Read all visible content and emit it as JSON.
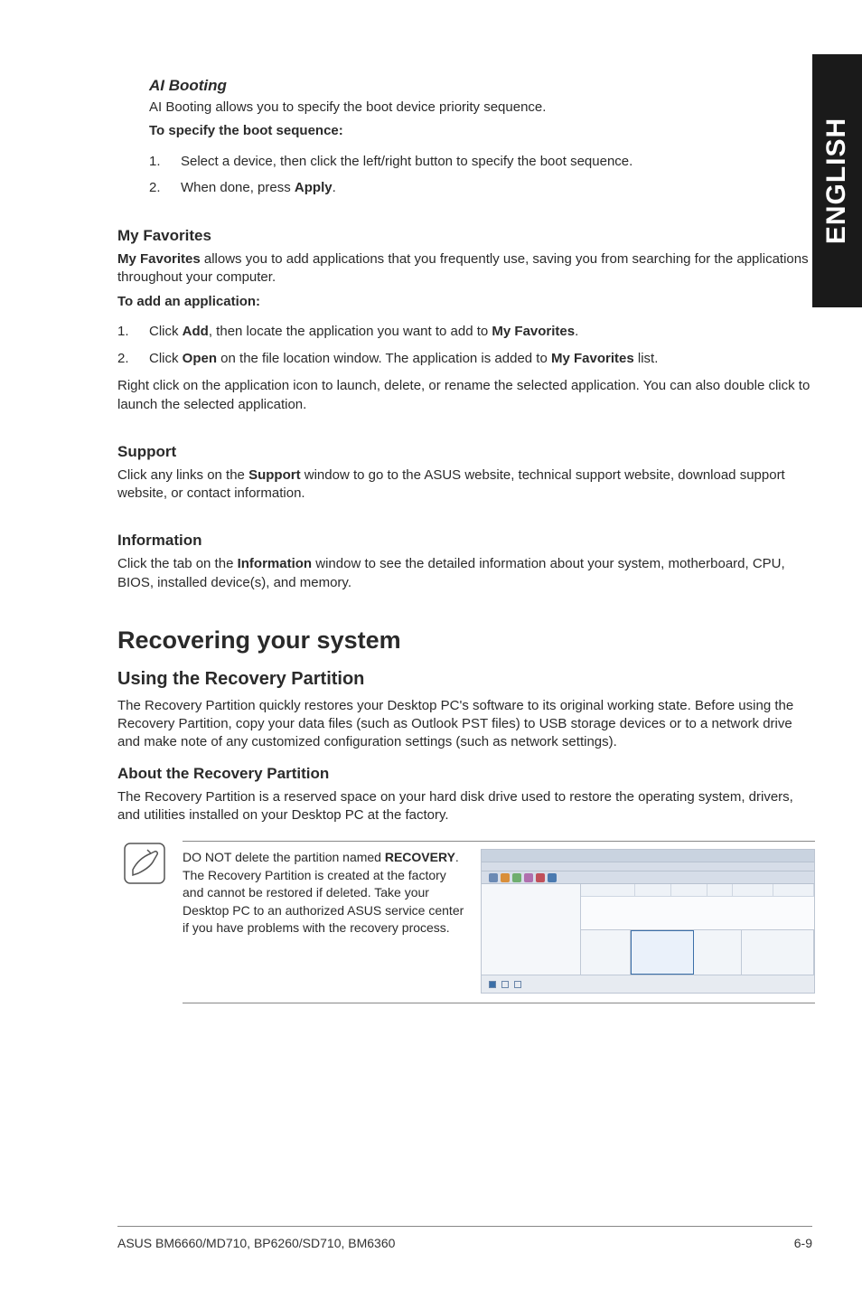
{
  "sideTab": "ENGLISH",
  "aiBooting": {
    "heading": "AI Booting",
    "intro": "AI Booting allows you to specify the boot device priority sequence.",
    "toSpecify": "To specify the boot sequence:",
    "steps": [
      {
        "n": "1.",
        "text_before": "Select a device, then click the left/right button to specify the boot sequence.",
        "bold": "",
        "text_after": ""
      },
      {
        "n": "2.",
        "text_before": "When done, press ",
        "bold": "Apply",
        "text_after": "."
      }
    ]
  },
  "myFav": {
    "heading": "My Favorites",
    "para_b1": "My Favorites",
    "para_t1": " allows you to add applications that you frequently use, saving you from searching for the applications throughout your computer.",
    "toAdd": "To add an application:",
    "steps": [
      {
        "n": "1.",
        "segs": [
          "Click ",
          "Add",
          ", then locate the application you want to add to ",
          "My Favorites",
          "."
        ]
      },
      {
        "n": "2.",
        "segs": [
          "Click ",
          "Open",
          " on the file location window. The application is added to ",
          "My Favorites",
          " list."
        ]
      }
    ],
    "post": "Right click on the application icon to launch, delete, or rename the selected application. You can also double click to launch the selected application."
  },
  "support": {
    "heading": "Support",
    "para_before": "Click any links on the ",
    "para_bold": "Support",
    "para_after": " window to go to the ASUS website, technical support website, download support website, or contact information."
  },
  "info": {
    "heading": "Information",
    "para_before": "Click the tab on the ",
    "para_bold": "Information",
    "para_after": " window to see the detailed information about your system, motherboard, CPU, BIOS, installed device(s), and memory."
  },
  "recovering": {
    "heading": "Recovering your system",
    "sub": "Using the Recovery Partition",
    "para": "The Recovery Partition quickly restores your Desktop PC's software to its original working state. Before using the Recovery Partition, copy your data files (such as Outlook PST files) to USB storage devices or to a network drive and make note of any customized configuration settings (such as network settings).",
    "about": "About the Recovery Partition",
    "aboutPara": "The Recovery Partition is a reserved space on your hard disk drive used to restore the operating system, drivers, and utilities installed on your Desktop PC at the factory."
  },
  "note": {
    "seg1": "DO NOT delete the partition named ",
    "bold1": "RECOVERY",
    "seg2": ". The Recovery Partition is created at the factory and cannot be restored if deleted. Take your Desktop PC to an authorized ASUS service center if you have problems with the recovery process."
  },
  "footer": {
    "left": "ASUS BM6660/MD710, BP6260/SD710, BM6360",
    "right": "6-9"
  }
}
